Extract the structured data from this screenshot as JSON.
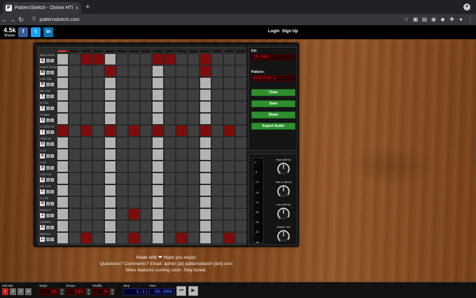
{
  "browser": {
    "tab_title": "PatternSketch - Online HTML5 ...",
    "favicon_letter": "P",
    "tab_close": "×",
    "new_tab": "+",
    "url": "patternsketch.com",
    "back": "←",
    "forward": "→",
    "reload": "↻",
    "lock": "🔒"
  },
  "site_header": {
    "shares_count": "4.5k",
    "shares_label": "Shares",
    "social": [
      {
        "name": "facebook",
        "glyph": "f",
        "color": "#3b5998"
      },
      {
        "name": "twitter",
        "glyph": "t",
        "color": "#1da1f2"
      },
      {
        "name": "linkedin",
        "glyph": "in",
        "color": "#0077b5"
      }
    ],
    "login": "Login",
    "signup": "Sign Up"
  },
  "sequencer": {
    "current_step": 1,
    "tracks": [
      {
        "name": "BASS DRUM",
        "key": "Q",
        "mute": "M",
        "solo": "S",
        "vol_label": "Vol",
        "steps": [
          0,
          0,
          1,
          1,
          0,
          0,
          0,
          0,
          1,
          1,
          0,
          0,
          1,
          0,
          0,
          0
        ]
      },
      {
        "name": "SNARE DRUM",
        "key": "W",
        "mute": "M",
        "solo": "S",
        "vol_label": "Vol",
        "steps": [
          0,
          0,
          0,
          0,
          1,
          0,
          0,
          0,
          0,
          0,
          0,
          0,
          1,
          0,
          0,
          0
        ]
      },
      {
        "name": "LOW TOM",
        "key": "R",
        "mute": "M",
        "solo": "S",
        "vol_label": "Vol",
        "steps": [
          0,
          0,
          0,
          0,
          0,
          0,
          0,
          0,
          0,
          0,
          0,
          0,
          0,
          0,
          0,
          0
        ]
      },
      {
        "name": "MID TOM",
        "key": "T",
        "mute": "M",
        "solo": "S",
        "vol_label": "Vol",
        "steps": [
          0,
          0,
          0,
          0,
          0,
          0,
          0,
          0,
          0,
          0,
          0,
          0,
          0,
          0,
          0,
          0
        ]
      },
      {
        "name": "HI TOM",
        "key": "Y",
        "mute": "M",
        "solo": "S",
        "vol_label": "Vol",
        "steps": [
          0,
          0,
          0,
          0,
          0,
          0,
          0,
          0,
          0,
          0,
          0,
          0,
          0,
          0,
          0,
          0
        ]
      },
      {
        "name": "CYMBAL",
        "key": "U",
        "mute": "M",
        "solo": "S",
        "vol_label": "Vol",
        "steps": [
          0,
          0,
          0,
          0,
          0,
          0,
          0,
          0,
          0,
          0,
          0,
          0,
          0,
          0,
          0,
          0
        ]
      },
      {
        "name": "CLOSED HH",
        "key": "I",
        "mute": "M",
        "solo": "S",
        "vol_label": "Vol",
        "steps": [
          1,
          0,
          1,
          0,
          1,
          0,
          1,
          0,
          1,
          0,
          1,
          0,
          1,
          0,
          1,
          0
        ]
      },
      {
        "name": "OPEN HH",
        "key": "O",
        "mute": "M",
        "solo": "S",
        "vol_label": "Vol",
        "steps": [
          0,
          0,
          0,
          0,
          0,
          0,
          0,
          0,
          0,
          0,
          0,
          0,
          0,
          0,
          0,
          0
        ]
      },
      {
        "name": "CLAP",
        "key": "A",
        "mute": "M",
        "solo": "S",
        "vol_label": "Vol",
        "steps": [
          0,
          0,
          0,
          0,
          0,
          0,
          0,
          0,
          0,
          0,
          0,
          0,
          0,
          0,
          0,
          0
        ]
      },
      {
        "name": "CLAP",
        "key": "S",
        "mute": "M",
        "solo": "S",
        "vol_label": "Vol",
        "steps": [
          0,
          0,
          0,
          0,
          0,
          0,
          0,
          0,
          0,
          0,
          0,
          0,
          0,
          0,
          0,
          0
        ]
      },
      {
        "name": "LOW CON",
        "key": "D",
        "mute": "M",
        "solo": "S",
        "vol_label": "Vol",
        "steps": [
          0,
          0,
          0,
          0,
          0,
          0,
          0,
          0,
          0,
          0,
          0,
          0,
          0,
          0,
          0,
          0
        ]
      },
      {
        "name": "MID CON",
        "key": "F",
        "mute": "M",
        "solo": "S",
        "vol_label": "Vol",
        "steps": [
          0,
          0,
          0,
          0,
          0,
          0,
          0,
          0,
          0,
          0,
          0,
          0,
          0,
          0,
          0,
          0
        ]
      },
      {
        "name": "HI CON",
        "key": "H",
        "mute": "M",
        "solo": "S",
        "vol_label": "Vol",
        "steps": [
          0,
          0,
          0,
          0,
          0,
          0,
          0,
          0,
          0,
          0,
          0,
          0,
          0,
          0,
          0,
          0
        ]
      },
      {
        "name": "RIMSHOT",
        "key": "J",
        "mute": "M",
        "solo": "S",
        "vol_label": "Vol",
        "steps": [
          0,
          0,
          0,
          0,
          0,
          0,
          1,
          0,
          0,
          0,
          0,
          0,
          0,
          0,
          0,
          0
        ]
      },
      {
        "name": "COWBELL",
        "key": "K",
        "mute": "M",
        "solo": "S",
        "vol_label": "Vol",
        "steps": [
          0,
          0,
          0,
          0,
          0,
          0,
          0,
          0,
          0,
          0,
          0,
          0,
          0,
          0,
          0,
          0
        ]
      },
      {
        "name": "MARACA",
        "key": "L",
        "mute": "M",
        "solo": "S",
        "vol_label": "Vol",
        "steps": [
          0,
          0,
          1,
          0,
          0,
          0,
          1,
          0,
          0,
          0,
          1,
          0,
          0,
          0,
          1,
          0
        ]
      }
    ],
    "colors": {
      "off": "#3e3e3e",
      "beat": "#b3b3b3",
      "on": "#7d0c0c"
    }
  },
  "side_panel": {
    "kit_label": "Kit:",
    "kit_value": "TR-909",
    "pattern_label": "Pattern:",
    "pattern_value": "ELECTRO 1",
    "buttons": [
      "Clear",
      "Save",
      "Share",
      "Export Audio"
    ],
    "meter_labels": [
      "0",
      "-6",
      "-12",
      "-18",
      "-24",
      "-30",
      "-36",
      "-42",
      "-48"
    ],
    "knobs": [
      "High (6kHz)",
      "Mid (1.5kHz)",
      "Low (80Hz)",
      "Master Vol"
    ]
  },
  "footer": {
    "line1": "Made with ❤ Hope you enjoy!",
    "line2": "Questions? Comments? Email: admin [at] patternsketch [dot] com",
    "line3": "More features coming soon. Stay tuned."
  },
  "transport": {
    "edit_bar_label": "Edit Bar",
    "bars": [
      "1",
      "2",
      "3",
      "4"
    ],
    "steps_label": "Steps",
    "steps_value": "16",
    "tempo_label": "Tempo",
    "tempo_value": "135",
    "shuffle_label": "Shuffle",
    "shuffle_value": "0",
    "step_label": "Step",
    "step_value": "1.1",
    "time_label": "Time",
    "time_value": "00.000",
    "rewind": "⏮",
    "play": "▶"
  }
}
